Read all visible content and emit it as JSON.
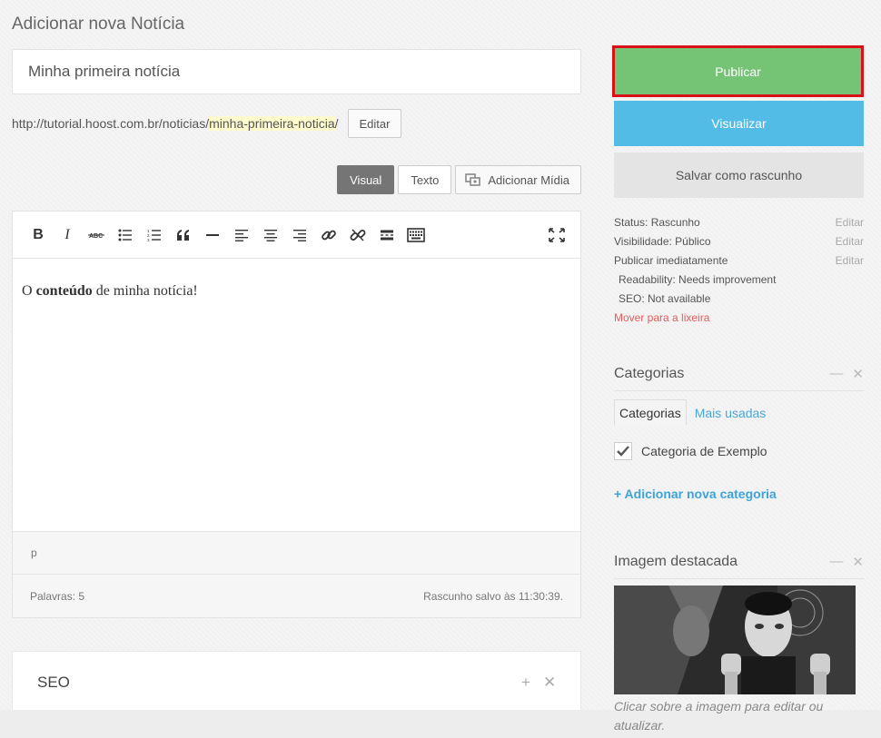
{
  "page": {
    "title": "Adicionar nova Notícia"
  },
  "post": {
    "title_value": "Minha primeira notícia",
    "permalink_base": "http://tutorial.hoost.com.br/noticias/",
    "permalink_slug": "minha-primeira-noticia",
    "permalink_suffix": "/",
    "permalink_edit": "Editar"
  },
  "editor": {
    "tab_visual": "Visual",
    "tab_text": "Texto",
    "add_media": "Adicionar Mídia",
    "toolbar": {
      "bold": "B",
      "italic": "I"
    },
    "content": {
      "pre": "O ",
      "bold": "conteúdo",
      "post": " de minha notícia!"
    },
    "path": "p",
    "word_count": "Palavras: 5",
    "autosave": "Rascunho salvo às 11:30:39."
  },
  "seo_box": {
    "title": "SEO",
    "add": "+",
    "close": "✕"
  },
  "publish": {
    "publish_label": "Publicar",
    "preview_label": "Visualizar",
    "draft_label": "Salvar como rascunho",
    "status": "Status: Rascunho",
    "visibility": "Visibilidade: Público",
    "schedule": "Publicar imediatamente",
    "edit": "Editar",
    "readability": "Readability: Needs improvement",
    "seo": "SEO: Not available",
    "trash": "Mover para a lixeira",
    "accent_publish": "#75c374",
    "accent_preview": "#52bce7",
    "highlight_border": "#d9101a"
  },
  "categories": {
    "title": "Categorias",
    "minimize": "—",
    "close": "✕",
    "tab_all": "Categorias",
    "tab_popular": "Mais usadas",
    "items": [
      {
        "label": "Categoria de Exemplo",
        "checked": true
      }
    ],
    "add_new": "+ Adicionar nova categoria"
  },
  "featured_image": {
    "title": "Imagem destacada",
    "minimize": "—",
    "close": "✕",
    "caption": "Clicar sobre a imagem para editar ou atualizar."
  }
}
